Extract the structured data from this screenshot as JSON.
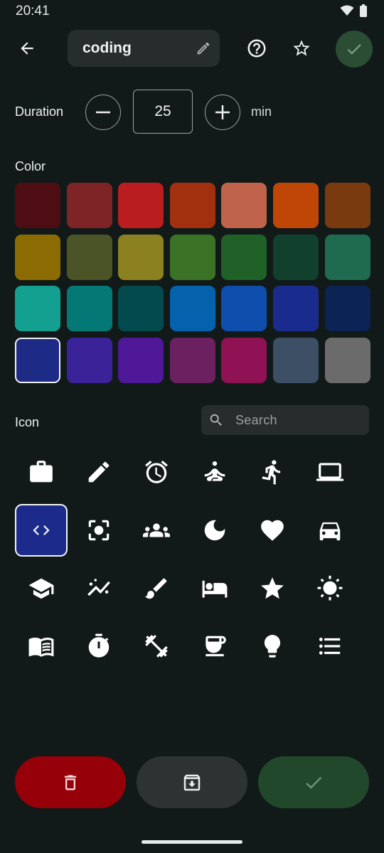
{
  "status_bar": {
    "time": "20:41"
  },
  "header": {
    "title": "coding"
  },
  "duration": {
    "label": "Duration",
    "value": "25",
    "unit": "min"
  },
  "color_section": {
    "label": "Color",
    "selected_index": 21,
    "swatches": [
      "#4e0d12",
      "#7f2426",
      "#b91d20",
      "#a2300f",
      "#bf634b",
      "#bf4606",
      "#7a3a10",
      "#8c6b02",
      "#4a5426",
      "#8b8120",
      "#3b7226",
      "#1f6126",
      "#12402f",
      "#1f6b50",
      "#13a091",
      "#047874",
      "#034a4e",
      "#0462ac",
      "#0f4eac",
      "#192c8e",
      "#0b2355",
      "#1e2b86",
      "#3a2299",
      "#4e1898",
      "#6b2060",
      "#8e1254",
      "#3c4f64",
      "#6b6b6b"
    ]
  },
  "icon_section": {
    "label": "Icon",
    "search_placeholder": "Search",
    "selected_index": 6,
    "icons": [
      "briefcase-icon",
      "pencil-icon",
      "alarm-icon",
      "meditation-icon",
      "running-icon",
      "laptop-icon",
      "code-icon",
      "center-focus-icon",
      "groups-icon",
      "moon-icon",
      "heart-icon",
      "car-icon",
      "school-icon",
      "trending-icon",
      "brush-icon",
      "bed-icon",
      "star-icon",
      "sun-icon",
      "book-icon",
      "timer-icon",
      "fitness-icon",
      "coffee-icon",
      "lightbulb-icon",
      "list-icon"
    ]
  },
  "colors": {
    "background": "#121a19",
    "delete": "#950009",
    "archive": "#2d3333",
    "confirm": "#22482b",
    "selection": "#1c2a8c"
  }
}
